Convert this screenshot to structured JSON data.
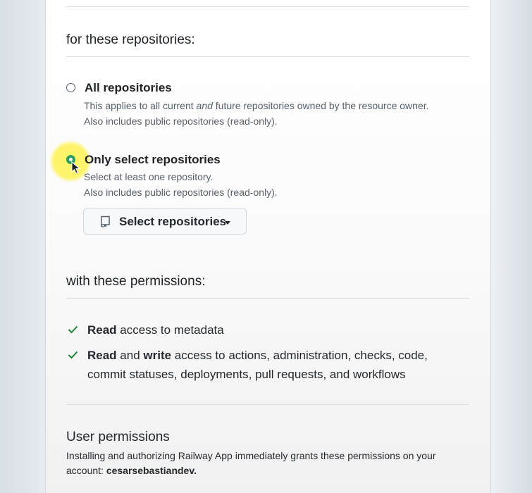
{
  "repositories": {
    "heading": "for these repositories:",
    "options": [
      {
        "title": "All repositories",
        "desc_line1_pre": "This applies to all current ",
        "desc_line1_em": "and",
        "desc_line1_post": " future repositories owned by the resource owner.",
        "desc_line2": "Also includes public repositories (read-only).",
        "selected": false
      },
      {
        "title": "Only select repositories",
        "desc_line1": "Select at least one repository.",
        "desc_line2": "Also includes public repositories (read-only).",
        "selected": true
      }
    ],
    "select_button": "Select repositories"
  },
  "permissions": {
    "heading": "with these permissions:",
    "items": [
      {
        "bold1": "Read",
        "text1": " access to metadata"
      },
      {
        "bold1": "Read",
        "text1": " and ",
        "bold2": "write",
        "text2": " access to actions, administration, checks, code,",
        "line2": "commit statuses, deployments, pull requests, and workflows"
      }
    ]
  },
  "user_permissions": {
    "title": "User permissions",
    "desc_line1": "Installing and authorizing Railway App immediately grants these permissions on your",
    "desc_line2_pre": "account: ",
    "account": "cesarsebastiandev."
  },
  "colors": {
    "check": "#1a7f37",
    "radio_selected": "#2f9e62",
    "highlight": "#fff25c"
  },
  "icons": [
    "repo-icon",
    "caret-down-icon",
    "check-icon",
    "cursor-icon"
  ]
}
